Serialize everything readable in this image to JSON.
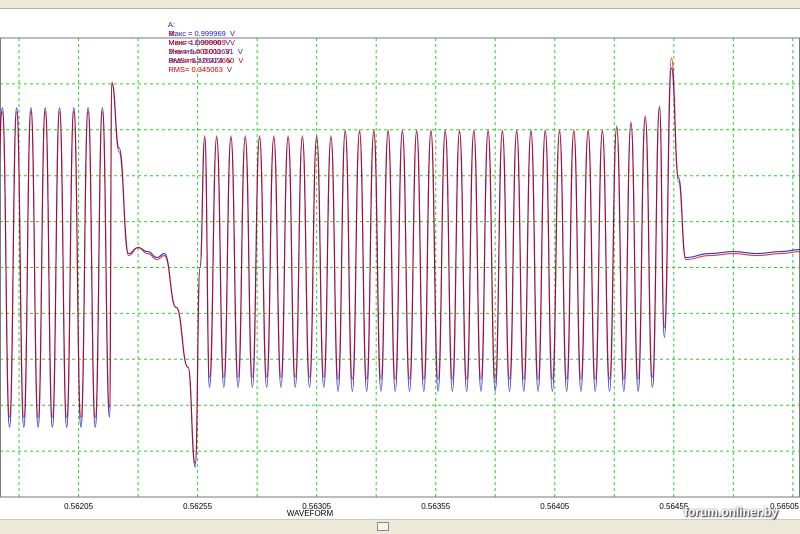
{
  "stats": {
    "a": {
      "name": "A:",
      "max": "Макс = 0.999969  V",
      "min": "Мин=-1.000000  V",
      "mean": "Значить= 0.011631  V",
      "rms": "RMS= 0.326424  V"
    },
    "b": {
      "name": "B:",
      "max": "Макс = 0.999969  V",
      "min": "Мин=-1.000000  V",
      "mean": "Значить= 0.012660  V",
      "rms": "RMS= 0.345063  V"
    }
  },
  "colors": {
    "series_a": "#1f1fbf",
    "series_b": "#cc0000",
    "grid": "#33cc33",
    "background": "#ffffff"
  },
  "watermark": "forum.onliner.by",
  "chart_data": {
    "type": "line",
    "xlabel": "WAVEFORM",
    "xlim": [
      0.56172,
      0.56508
    ],
    "ylim": [
      -1.15,
      1.15
    ],
    "x_ticks": [
      "0.56205",
      "0.56255",
      "0.56305",
      "0.56355",
      "0.56405",
      "0.56455",
      "0.56505"
    ],
    "x_tick_values": [
      0.56205,
      0.56255,
      0.56305,
      0.56355,
      0.56405,
      0.56455,
      0.56505
    ],
    "grid": true,
    "series": [
      {
        "name": "A",
        "points": [
          [
            0.5617,
            0.0
          ],
          [
            0.56173,
            0.8
          ],
          [
            0.56176,
            -0.8
          ],
          [
            0.56179,
            0.8
          ],
          [
            0.56182,
            -0.8
          ],
          [
            0.56185,
            0.8
          ],
          [
            0.56188,
            -0.8
          ],
          [
            0.56191,
            0.8
          ],
          [
            0.56194,
            -0.8
          ],
          [
            0.56197,
            0.8
          ],
          [
            0.562,
            -0.8
          ],
          [
            0.56203,
            0.8
          ],
          [
            0.56206,
            -0.8
          ],
          [
            0.56209,
            0.8
          ],
          [
            0.56212,
            -0.8
          ],
          [
            0.56215,
            0.8
          ],
          [
            0.56218,
            -0.75
          ],
          [
            0.56219,
            0.92
          ],
          [
            0.56222,
            0.6
          ],
          [
            0.56226,
            0.07
          ],
          [
            0.5623,
            0.1
          ],
          [
            0.56234,
            0.08
          ],
          [
            0.56238,
            0.05
          ],
          [
            0.56241,
            0.07
          ],
          [
            0.56246,
            -0.2
          ],
          [
            0.56251,
            -0.5
          ],
          [
            0.56254,
            -1.0
          ],
          [
            0.56256,
            0.0
          ],
          [
            0.56258,
            0.65
          ],
          [
            0.5626,
            -0.6
          ],
          [
            0.56263,
            0.65
          ],
          [
            0.56266,
            -0.6
          ],
          [
            0.56269,
            0.65
          ],
          [
            0.56272,
            -0.6
          ],
          [
            0.56275,
            0.65
          ],
          [
            0.56278,
            -0.6
          ],
          [
            0.56281,
            0.65
          ],
          [
            0.56284,
            -0.6
          ],
          [
            0.56287,
            0.65
          ],
          [
            0.5629,
            -0.6
          ],
          [
            0.56293,
            0.65
          ],
          [
            0.56296,
            -0.6
          ],
          [
            0.56299,
            0.65
          ],
          [
            0.56302,
            -0.6
          ],
          [
            0.56305,
            0.65
          ],
          [
            0.56308,
            -0.6
          ],
          [
            0.56311,
            0.65
          ],
          [
            0.56314,
            -0.62
          ],
          [
            0.56317,
            0.68
          ],
          [
            0.5632,
            -0.62
          ],
          [
            0.56323,
            0.68
          ],
          [
            0.56326,
            -0.62
          ],
          [
            0.56329,
            0.68
          ],
          [
            0.56332,
            -0.62
          ],
          [
            0.56335,
            0.68
          ],
          [
            0.56338,
            -0.62
          ],
          [
            0.56341,
            0.68
          ],
          [
            0.56344,
            -0.62
          ],
          [
            0.56347,
            0.68
          ],
          [
            0.5635,
            -0.62
          ],
          [
            0.56353,
            0.68
          ],
          [
            0.56356,
            -0.62
          ],
          [
            0.56359,
            0.68
          ],
          [
            0.56362,
            -0.62
          ],
          [
            0.56365,
            0.68
          ],
          [
            0.56368,
            -0.62
          ],
          [
            0.56371,
            0.68
          ],
          [
            0.56374,
            -0.62
          ],
          [
            0.56377,
            0.68
          ],
          [
            0.5638,
            -0.62
          ],
          [
            0.56383,
            0.68
          ],
          [
            0.56386,
            -0.62
          ],
          [
            0.56389,
            0.68
          ],
          [
            0.56392,
            -0.62
          ],
          [
            0.56395,
            0.68
          ],
          [
            0.56398,
            -0.62
          ],
          [
            0.56401,
            0.68
          ],
          [
            0.56404,
            -0.62
          ],
          [
            0.56407,
            0.68
          ],
          [
            0.5641,
            -0.62
          ],
          [
            0.56413,
            0.68
          ],
          [
            0.56416,
            -0.62
          ],
          [
            0.56419,
            0.68
          ],
          [
            0.56422,
            -0.62
          ],
          [
            0.56425,
            0.68
          ],
          [
            0.56428,
            -0.62
          ],
          [
            0.56431,
            0.7
          ],
          [
            0.56434,
            -0.62
          ],
          [
            0.56437,
            0.72
          ],
          [
            0.5644,
            -0.62
          ],
          [
            0.56443,
            0.75
          ],
          [
            0.56446,
            -0.6
          ],
          [
            0.56449,
            0.8
          ],
          [
            0.56451,
            -0.35
          ],
          [
            0.56454,
            1.0
          ],
          [
            0.56457,
            0.45
          ],
          [
            0.5646,
            0.05
          ],
          [
            0.5647,
            0.07
          ],
          [
            0.5648,
            0.08
          ],
          [
            0.5649,
            0.07
          ],
          [
            0.565,
            0.08
          ],
          [
            0.56508,
            0.09
          ]
        ]
      },
      {
        "name": "B",
        "points": [
          [
            0.5617,
            0.0
          ],
          [
            0.56173,
            0.78
          ],
          [
            0.56176,
            -0.75
          ],
          [
            0.56179,
            0.78
          ],
          [
            0.56182,
            -0.75
          ],
          [
            0.56185,
            0.78
          ],
          [
            0.56188,
            -0.75
          ],
          [
            0.56191,
            0.78
          ],
          [
            0.56194,
            -0.75
          ],
          [
            0.56197,
            0.78
          ],
          [
            0.562,
            -0.75
          ],
          [
            0.56203,
            0.78
          ],
          [
            0.56206,
            -0.75
          ],
          [
            0.56209,
            0.78
          ],
          [
            0.56212,
            -0.75
          ],
          [
            0.56215,
            0.78
          ],
          [
            0.56218,
            -0.7
          ],
          [
            0.56219,
            0.93
          ],
          [
            0.56222,
            0.58
          ],
          [
            0.56226,
            0.06
          ],
          [
            0.5623,
            0.1
          ],
          [
            0.56234,
            0.07
          ],
          [
            0.56238,
            0.04
          ],
          [
            0.56241,
            0.06
          ],
          [
            0.56246,
            -0.2
          ],
          [
            0.56251,
            -0.5
          ],
          [
            0.56254,
            -0.98
          ],
          [
            0.56256,
            0.0
          ],
          [
            0.56258,
            0.66
          ],
          [
            0.5626,
            -0.55
          ],
          [
            0.56263,
            0.66
          ],
          [
            0.56266,
            -0.55
          ],
          [
            0.56269,
            0.66
          ],
          [
            0.56272,
            -0.55
          ],
          [
            0.56275,
            0.66
          ],
          [
            0.56278,
            -0.55
          ],
          [
            0.56281,
            0.66
          ],
          [
            0.56284,
            -0.55
          ],
          [
            0.56287,
            0.66
          ],
          [
            0.5629,
            -0.55
          ],
          [
            0.56293,
            0.66
          ],
          [
            0.56296,
            -0.55
          ],
          [
            0.56299,
            0.66
          ],
          [
            0.56302,
            -0.55
          ],
          [
            0.56305,
            0.66
          ],
          [
            0.56308,
            -0.55
          ],
          [
            0.56311,
            0.66
          ],
          [
            0.56314,
            -0.56
          ],
          [
            0.56317,
            0.69
          ],
          [
            0.5632,
            -0.56
          ],
          [
            0.56323,
            0.69
          ],
          [
            0.56326,
            -0.56
          ],
          [
            0.56329,
            0.69
          ],
          [
            0.56332,
            -0.56
          ],
          [
            0.56335,
            0.69
          ],
          [
            0.56338,
            -0.56
          ],
          [
            0.56341,
            0.69
          ],
          [
            0.56344,
            -0.56
          ],
          [
            0.56347,
            0.69
          ],
          [
            0.5635,
            -0.56
          ],
          [
            0.56353,
            0.69
          ],
          [
            0.56356,
            -0.56
          ],
          [
            0.56359,
            0.69
          ],
          [
            0.56362,
            -0.56
          ],
          [
            0.56365,
            0.69
          ],
          [
            0.56368,
            -0.56
          ],
          [
            0.56371,
            0.69
          ],
          [
            0.56374,
            -0.56
          ],
          [
            0.56377,
            0.69
          ],
          [
            0.5638,
            -0.56
          ],
          [
            0.56383,
            0.69
          ],
          [
            0.56386,
            -0.56
          ],
          [
            0.56389,
            0.69
          ],
          [
            0.56392,
            -0.56
          ],
          [
            0.56395,
            0.69
          ],
          [
            0.56398,
            -0.56
          ],
          [
            0.56401,
            0.69
          ],
          [
            0.56404,
            -0.56
          ],
          [
            0.56407,
            0.69
          ],
          [
            0.5641,
            -0.56
          ],
          [
            0.56413,
            0.69
          ],
          [
            0.56416,
            -0.56
          ],
          [
            0.56419,
            0.69
          ],
          [
            0.56422,
            -0.56
          ],
          [
            0.56425,
            0.69
          ],
          [
            0.56428,
            -0.56
          ],
          [
            0.56431,
            0.71
          ],
          [
            0.56434,
            -0.56
          ],
          [
            0.56437,
            0.73
          ],
          [
            0.5644,
            -0.56
          ],
          [
            0.56443,
            0.76
          ],
          [
            0.56446,
            -0.55
          ],
          [
            0.56449,
            0.81
          ],
          [
            0.56451,
            -0.3
          ],
          [
            0.56454,
            1.05
          ],
          [
            0.56457,
            0.43
          ],
          [
            0.5646,
            0.04
          ],
          [
            0.5647,
            0.06
          ],
          [
            0.5648,
            0.07
          ],
          [
            0.5649,
            0.06
          ],
          [
            0.565,
            0.07
          ],
          [
            0.56508,
            0.08
          ]
        ]
      }
    ]
  }
}
